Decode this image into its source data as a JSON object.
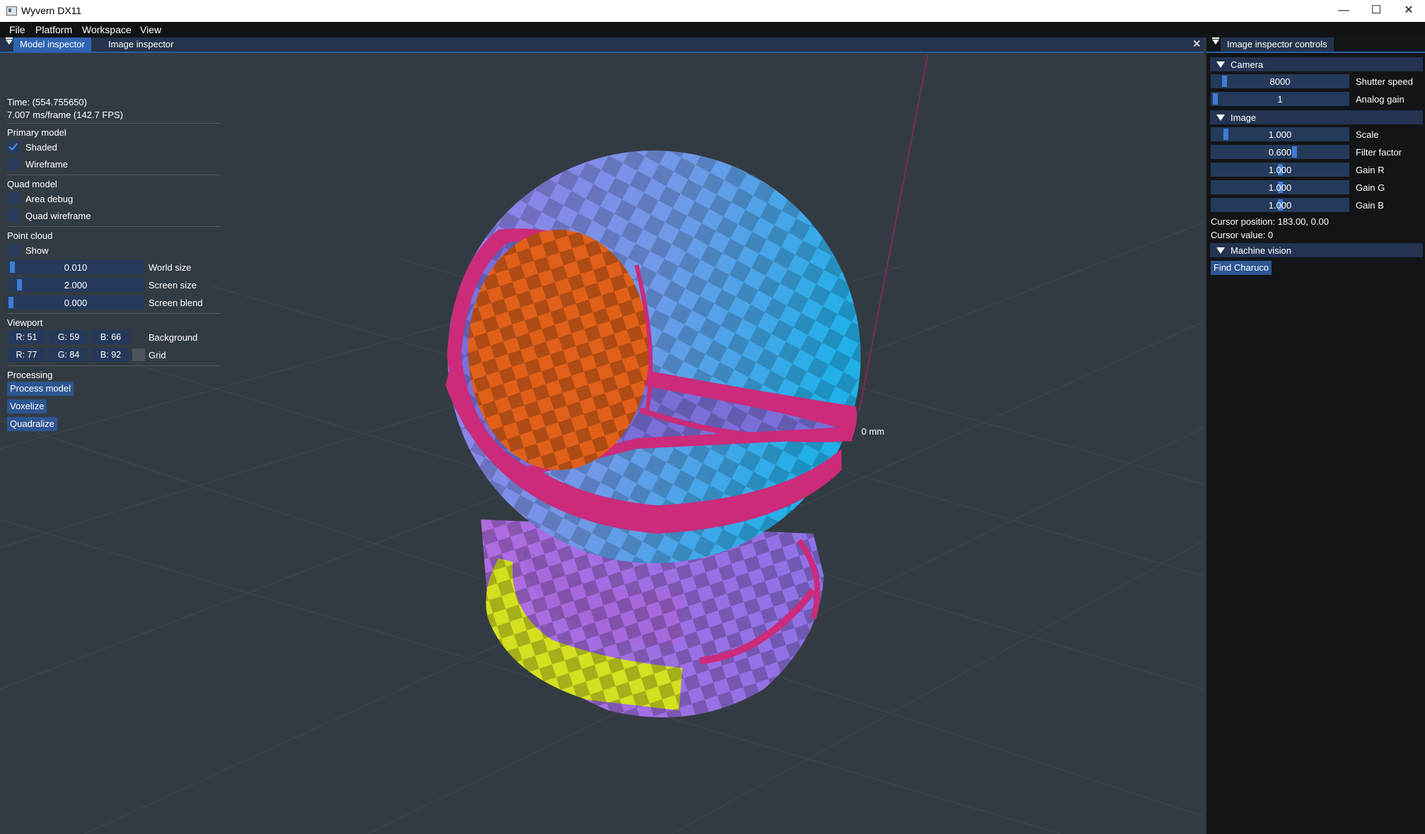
{
  "window": {
    "title": "Wyvern DX11",
    "minimize_glyph": "—",
    "maximize_glyph": "☐",
    "close_glyph": "✕"
  },
  "menu": [
    "File",
    "Platform",
    "Workspace",
    "View"
  ],
  "main_tabs": {
    "tab1": "Model inspector",
    "tab2": "Image inspector",
    "close_glyph": "✕"
  },
  "inspector": {
    "time": "Time: (554.755650)",
    "frame": "7.007 ms/frame (142.7 FPS)",
    "primary_model": {
      "heading": "Primary model",
      "shaded": "Shaded",
      "shaded_checked": true,
      "wireframe": "Wireframe",
      "wireframe_checked": false
    },
    "quad_model": {
      "heading": "Quad model",
      "area_debug": "Area debug",
      "quad_wireframe": "Quad wireframe"
    },
    "point_cloud": {
      "heading": "Point cloud",
      "show": "Show",
      "world_size": {
        "value": "0.010",
        "label": "World size",
        "fraction": 0.01
      },
      "screen_size": {
        "value": "2.000",
        "label": "Screen size",
        "fraction": 0.07
      },
      "screen_blend": {
        "value": "0.000",
        "label": "Screen blend",
        "fraction": 0.0
      }
    },
    "viewport": {
      "heading": "Viewport",
      "background": {
        "r": "R: 51",
        "g": "G: 59",
        "b": "B: 66",
        "label": "Background",
        "color": "#333b42"
      },
      "grid": {
        "r": "R: 77",
        "g": "G: 84",
        "b": "B: 92",
        "label": "Grid",
        "color": "#4d545c"
      }
    },
    "processing": {
      "heading": "Processing",
      "process_model": "Process model",
      "voxelize": "Voxelize",
      "quadralize": "Quadralize"
    }
  },
  "scene": {
    "axis_label": "0 mm",
    "colors": {
      "blue": "#4b8fe0",
      "purple": "#9a78e8",
      "orange": "#e0601a",
      "yellow": "#d4e020",
      "magenta": "#cc2a7a"
    }
  },
  "controls": {
    "tab": "Image inspector controls",
    "camera": {
      "heading": "Camera",
      "shutter_speed": {
        "value": "8000",
        "label": "Shutter speed"
      },
      "analog_gain": {
        "value": "1",
        "label": "Analog gain"
      }
    },
    "image": {
      "heading": "Image",
      "scale": {
        "value": "1.000",
        "label": "Scale"
      },
      "filter_factor": {
        "value": "0.600",
        "label": "Filter factor"
      },
      "gain_r": {
        "value": "1.000",
        "label": "Gain R"
      },
      "gain_g": {
        "value": "1.000",
        "label": "Gain G"
      },
      "gain_b": {
        "value": "1.000",
        "label": "Gain B"
      },
      "cursor_position": "Cursor position: 183.00, 0.00",
      "cursor_value": "Cursor value: 0"
    },
    "machine_vision": {
      "heading": "Machine vision",
      "find_charuco": "Find Charuco"
    }
  }
}
